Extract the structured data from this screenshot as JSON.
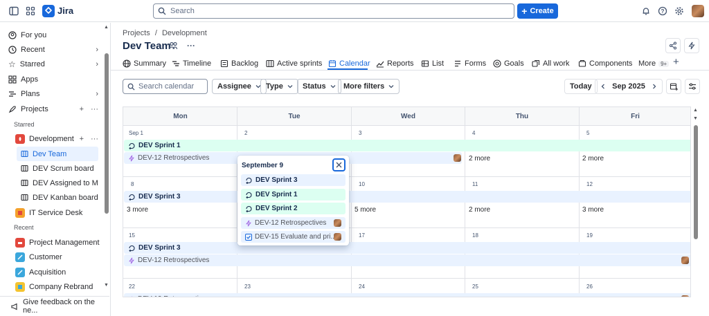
{
  "app": {
    "name": "Jira"
  },
  "topbar": {
    "search_placeholder": "Search",
    "create_label": "Create"
  },
  "sidebar": {
    "items": [
      {
        "label": "For you"
      },
      {
        "label": "Recent"
      },
      {
        "label": "Starred"
      },
      {
        "label": "Apps"
      },
      {
        "label": "Plans"
      },
      {
        "label": "Projects"
      }
    ],
    "starred_label": "Starred",
    "recent_label": "Recent",
    "project_development": "Development",
    "boards": [
      "Dev Team",
      "DEV Scrum board",
      "DEV Assigned to Me",
      "DEV Kanban board"
    ],
    "it_service_desk": "IT Service Desk",
    "recent_projects": [
      "Project Management",
      "Customer",
      "Acquisition",
      "Company Rebrand"
    ],
    "feedback": "Give feedback on the ne..."
  },
  "header": {
    "breadcrumb_projects": "Projects",
    "breadcrumb_sep": "/",
    "breadcrumb_dev": "Development",
    "title": "Dev Team",
    "more": "···"
  },
  "tabs": [
    {
      "label": "Summary"
    },
    {
      "label": "Timeline"
    },
    {
      "label": "Backlog"
    },
    {
      "label": "Active sprints"
    },
    {
      "label": "Calendar"
    },
    {
      "label": "Reports"
    },
    {
      "label": "List"
    },
    {
      "label": "Forms"
    },
    {
      "label": "Goals"
    },
    {
      "label": "All work"
    },
    {
      "label": "Components"
    },
    {
      "label": "More"
    }
  ],
  "more_badge": "9+",
  "filters": {
    "search_placeholder": "Search calendar",
    "assignee": "Assignee",
    "type": "Type",
    "status": "Status",
    "more_filters": "More filters",
    "today": "Today",
    "month": "Sep 2025"
  },
  "calendar": {
    "days": [
      "Mon",
      "Tue",
      "Wed",
      "Thu",
      "Fri"
    ],
    "week1": [
      "Sep 1",
      "2",
      "3",
      "4",
      "5"
    ],
    "week2": [
      "8",
      "9",
      "10",
      "11",
      "12"
    ],
    "week3": [
      "15",
      "16",
      "17",
      "18",
      "19"
    ],
    "week4": [
      "22",
      "23",
      "24",
      "25",
      "26"
    ],
    "sprint1": "DEV Sprint 1",
    "sprint3": "DEV Sprint 3",
    "retro": "DEV-12 Retrospectives",
    "more2": "2 more",
    "more3": "3 more",
    "more5": "5 more"
  },
  "popup": {
    "title": "September 9",
    "items": [
      "DEV Sprint 3",
      "DEV Sprint 1",
      "DEV Sprint 2",
      "DEV-12 Retrospectives",
      "DEV-15 Evaluate and pri..."
    ]
  },
  "colors": {
    "accent": "#1868db",
    "sprint_green": "#dcfff1",
    "sprint_blue": "#e9f2ff"
  }
}
